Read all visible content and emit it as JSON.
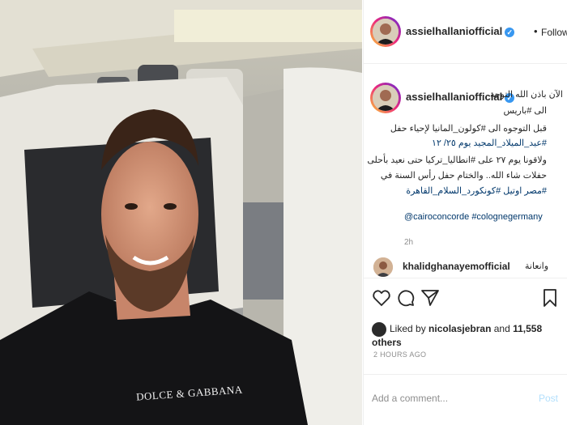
{
  "post": {
    "shirt_text": "DOLCE & GABBANA"
  },
  "header": {
    "username": "assielhallaniofficial",
    "verified_glyph": "✓",
    "separator": "•",
    "follow_label": "Following"
  },
  "caption": {
    "username": "assielhallaniofficial",
    "lines": [
      "الآن باذن الله التوجه",
      "الى #باريس",
      "قبل التوجوه الى #كولون_المانيا لإحياء حفل",
      "#عيد_الميلاد_المجيد يوم ٢٥/ ١٢",
      "ولاقونا يوم ٢٧ على #انطاليا_تركيا حتى نعيد بأحلى",
      "حفلات شاء الله.. والختام حفل رأس السنة في",
      "#مصر اوتيل #كونكورد_السلام_القاهرة",
      "@cairoconcorde #colognegermany"
    ],
    "time_ago": "2h"
  },
  "comment": {
    "username": "khalidghanayemofficial",
    "text": "وانعانة"
  },
  "actions": {
    "icons": [
      "heart-icon",
      "comment-icon",
      "share-icon",
      "bookmark-icon"
    ]
  },
  "likes": {
    "prefix": "Liked by ",
    "user": "nicolasjebran",
    "middle": " and ",
    "count": "11,558 others"
  },
  "timestamp": "2 HOURS AGO",
  "comment_input": {
    "placeholder": "Add a comment...",
    "post_label": "Post"
  },
  "colors": {
    "link": "#00376b",
    "verified": "#3897f0",
    "post_disabled": "#b2dffc"
  }
}
